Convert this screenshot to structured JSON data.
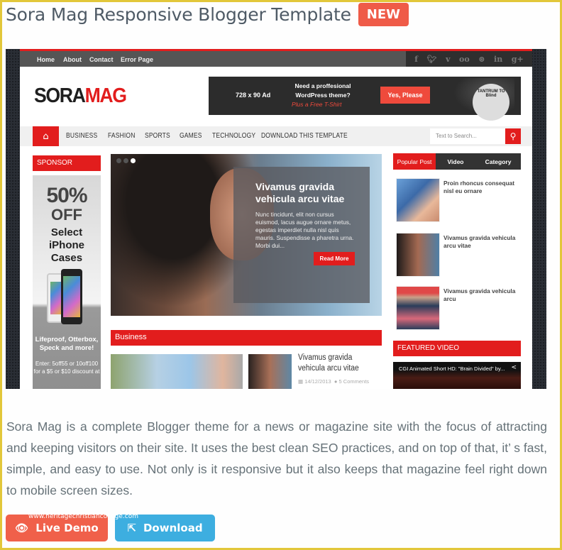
{
  "header": {
    "title": "Sora Mag Responsive Blogger Template",
    "badge": "NEW"
  },
  "preview": {
    "topnav": [
      "Home",
      "About",
      "Contact",
      "Error Page"
    ],
    "social_icons": [
      "f",
      "t",
      "v",
      "oo",
      "⊛",
      "in",
      "g+"
    ],
    "logo": {
      "part1": "SORA",
      "part2": "MAG"
    },
    "ad": {
      "size": "728 x 90 Ad",
      "headline": "Need a proffesional WordPress theme?",
      "sub": "Plus a Free T-Shirt",
      "cta": "Yes, Please",
      "badge": "TANTRUM TO Blind"
    },
    "menu": [
      "BUSINESS",
      "FASHION",
      "SPORTS",
      "GAMES",
      "TECHNOLOGY",
      "DOWNLOAD THIS TEMPLATE"
    ],
    "search_placeholder": "Text to Search...",
    "sponsor": {
      "heading": "SPONSOR",
      "big": "50%",
      "off": "OFF",
      "line1": "Select",
      "line2": "iPhone",
      "line3": "Cases",
      "brands": "Lifeproof, Otterbox, Speck and more!",
      "promo": "Enter: 5off55 or 10off100 for a $5 or $10 discount at"
    },
    "slider": {
      "title": "Vivamus gravida vehicula arcu vitae",
      "excerpt": "Nunc tincidunt, elit non cursus euismod, lacus augue ornare metus, egestas imperdiet nulla nisl quis mauris. Suspendisse a pharetra urna. Morbi dui...",
      "read_more": "Read More",
      "dots": 3,
      "active_dot": 3
    },
    "business": {
      "heading": "Business",
      "post_title": "Vivamus gravida vehicula arcu vitae",
      "date": "14/12/2013",
      "comments": "5 Comments"
    },
    "sidebar_tabs": [
      "Popular Post",
      "Video",
      "Category"
    ],
    "popular_posts": [
      {
        "title": "Proin rhoncus consequat nisl eu ornare"
      },
      {
        "title": "Vivamus gravida vehicula arcu vitae"
      },
      {
        "title": "Vivamus gravida vehicula arcu"
      }
    ],
    "featured_video": {
      "heading": "FEATURED VIDEO",
      "title": "CGI Animated Short HD: \"Brain Divided\" by..."
    }
  },
  "description": "Sora Mag is a complete Blogger theme for a news or magazine site with the focus of attracting and keeping visitors on their site. It uses the best clean SEO practices, and on top of that, it’ s fast, simple, and easy to use. Not only is it responsive but it also keeps that magazine feel right down to mobile screen sizes.",
  "buttons": {
    "demo": "Live Demo",
    "download": "Download"
  },
  "watermark": "www.heritagechristiancollege.com",
  "colors": {
    "badge": "#ef5b48",
    "demo": "#f0604a",
    "download": "#3daee0",
    "accent_red": "#e21d1d",
    "frame": "#e2c73a"
  }
}
